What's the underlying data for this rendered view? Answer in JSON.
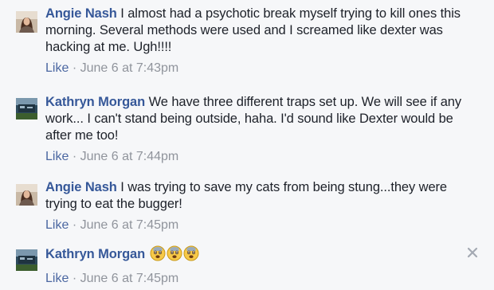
{
  "comments": [
    {
      "author": "Angie Nash",
      "avatar_icon": "profile-photo-woman-icon",
      "text": "I almost had a psychotic break myself trying to kill ones this morning. Several methods were used and I screamed like dexter was hacking at me. Ugh!!!!",
      "like_label": "Like",
      "separator": "·",
      "timestamp": "June 6 at 7:43pm"
    },
    {
      "author": "Kathryn Morgan",
      "avatar_icon": "profile-photo-landscape-icon",
      "text": "We have three different traps set up. We will see if any work... I can't stand being outside, haha. I'd sound like Dexter would be after me too!",
      "like_label": "Like",
      "separator": "·",
      "timestamp": "June 6 at 7:44pm"
    },
    {
      "author": "Angie Nash",
      "avatar_icon": "profile-photo-woman-icon",
      "text": "I was trying to save my cats from being stung...they were trying to eat the bugger!",
      "like_label": "Like",
      "separator": "·",
      "timestamp": "June 6 at 7:45pm"
    },
    {
      "author": "Kathryn Morgan",
      "avatar_icon": "profile-photo-landscape-icon",
      "text": "",
      "emojis": [
        "fearful-face-emoji",
        "fearful-face-emoji",
        "fearful-face-emoji"
      ],
      "like_label": "Like",
      "separator": "·",
      "timestamp": "June 6 at 7:45pm"
    }
  ],
  "close_icon": "close-x-icon",
  "colors": {
    "background": "#f6f7f9",
    "author_link": "#365899",
    "like_link": "#4b67a1",
    "meta_gray": "#90949c",
    "text": "#1d2129"
  }
}
